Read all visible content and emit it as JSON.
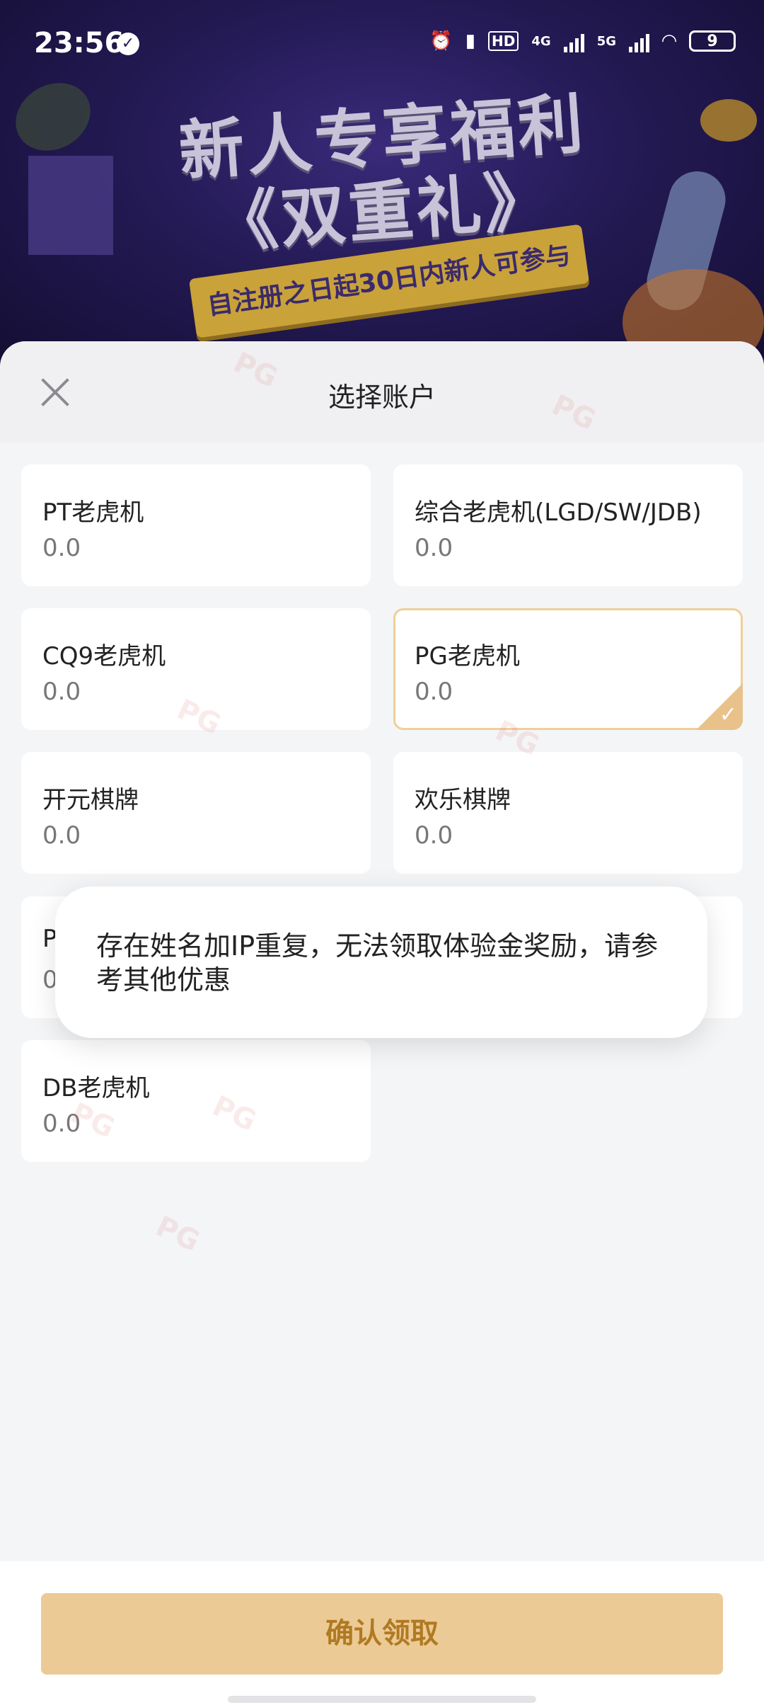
{
  "status_bar": {
    "time": "23:56",
    "network_1": "4G",
    "network_2": "5G",
    "battery": "9",
    "icons": [
      "check-circle-icon",
      "alarm-icon",
      "vibrate-icon",
      "hd-icon",
      "signal-icon",
      "wifi-icon",
      "battery-icon"
    ]
  },
  "banner": {
    "headline": "新人专享福利",
    "subheadline": "《双重礼》",
    "ribbon_text": "自注册之日起30日内新人可参与"
  },
  "sheet": {
    "title": "选择账户",
    "accounts": [
      {
        "name": "PT老虎机",
        "balance": "0.0",
        "selected": false
      },
      {
        "name": "综合老虎机(LGD/SW/JDB)",
        "balance": "0.0",
        "selected": false
      },
      {
        "name": "CQ9老虎机",
        "balance": "0.0",
        "selected": false
      },
      {
        "name": "PG老虎机",
        "balance": "0.0",
        "selected": true
      },
      {
        "name": "开元棋牌",
        "balance": "0.0",
        "selected": false
      },
      {
        "name": "欢乐棋牌",
        "balance": "0.0",
        "selected": false
      },
      {
        "name": "P",
        "balance": "0",
        "selected": false
      },
      {
        "name": "",
        "balance": "",
        "selected": false
      },
      {
        "name": "DB老虎机",
        "balance": "0.0",
        "selected": false
      }
    ]
  },
  "toast": {
    "message": "存在姓名加IP重复，无法领取体验金奖励，请参考其他优惠"
  },
  "footer": {
    "confirm_label": "确认领取"
  },
  "colors": {
    "accent": "#ecca96",
    "accent_text": "#b07a22",
    "selected_border": "#efcf99"
  }
}
